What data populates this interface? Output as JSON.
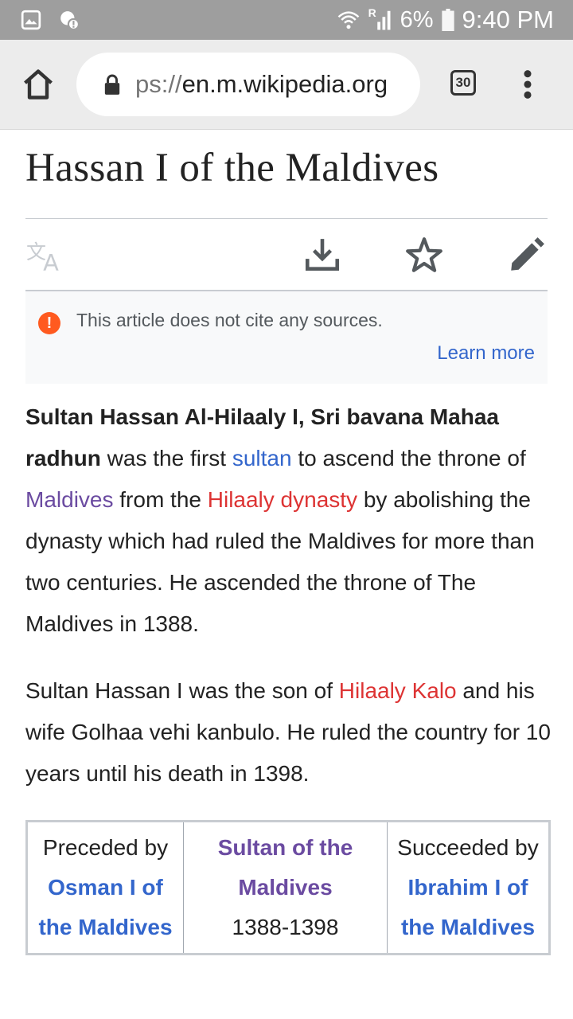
{
  "status_bar": {
    "icons": [
      "gallery-icon",
      "notification-icon",
      "wifi-icon",
      "signal-icon",
      "battery-icon"
    ],
    "roaming": "R",
    "battery": "6%",
    "time": "9:40 PM"
  },
  "browser": {
    "url_prefix": "ps://",
    "url_host": "en.m.wikipedia.org",
    "tab_count": "30"
  },
  "article": {
    "title": "Hassan I of the Maldives",
    "notice": {
      "message": "This article does not cite any sources.",
      "learn_more": "Learn more"
    },
    "p1": {
      "bold": "Sultan Hassan Al-Hilaaly I, Sri bavana Mahaa radhun",
      "t1": " was the first ",
      "link_sultan": "sultan",
      "t2": " to ascend the throne of ",
      "link_maldives": "Maldives",
      "t3": " from the ",
      "link_dynasty": "Hilaaly dynasty",
      "t4": " by abolishing the dynasty which had ruled the Maldives for more than two centuries. He ascended the throne of The Maldives in 1388."
    },
    "p2": {
      "t1": "Sultan Hassan I was the son of ",
      "link_kalo": "Hilaaly Kalo",
      "t2": " and his wife Golhaa vehi kanbulo. He ruled the country for 10 years until his death in 1398."
    },
    "succession": {
      "preceded_label": "Preceded by",
      "preceded_link_1": "Osman I of",
      "preceded_link_2": "the Maldives",
      "office_1": "Sultan of the",
      "office_2": "Maldives",
      "years": "1388-1398",
      "succeeded_label": "Succeeded by",
      "succeeded_link_1": "Ibrahim I of",
      "succeeded_link_2": "the Maldives"
    }
  },
  "colors": {
    "link": "#3366cc",
    "visited": "#6b4ba1",
    "redlink": "#d33",
    "warning": "#ff5a1f"
  }
}
